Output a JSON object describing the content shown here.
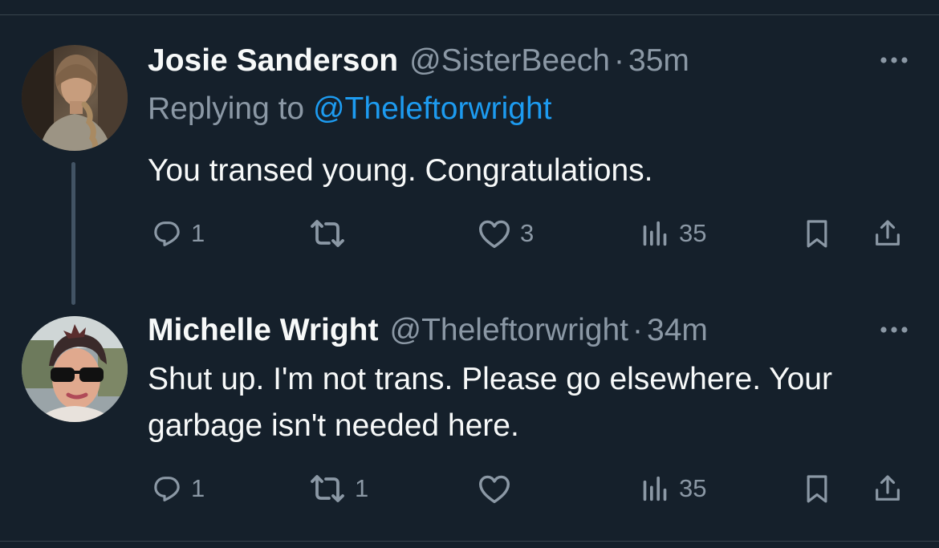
{
  "tweets": [
    {
      "author_name": "Josie Sanderson",
      "handle": "@SisterBeech",
      "separator": "·",
      "time": "35m",
      "replying_prefix": "Replying to",
      "replying_to": "@Theleftorwright",
      "text": "You transed young. Congratulations.",
      "replies": "1",
      "reposts": "",
      "likes": "3",
      "views": "35"
    },
    {
      "author_name": "Michelle Wright",
      "handle": "@Theleftorwright",
      "separator": "·",
      "time": "34m",
      "text": "Shut up. I'm not trans. Please go elsewhere. Your garbage isn't needed here.",
      "replies": "1",
      "reposts": "1",
      "likes": "",
      "views": "35"
    }
  ],
  "colors": {
    "background": "#15202b",
    "text_primary": "#f7f9f9",
    "text_secondary": "#8b98a5",
    "link": "#1d9bf0",
    "thread_line": "#425364",
    "divider": "#38444d"
  },
  "icons": [
    "more-icon",
    "reply-icon",
    "repost-icon",
    "like-icon",
    "views-icon",
    "bookmark-icon",
    "share-icon"
  ]
}
